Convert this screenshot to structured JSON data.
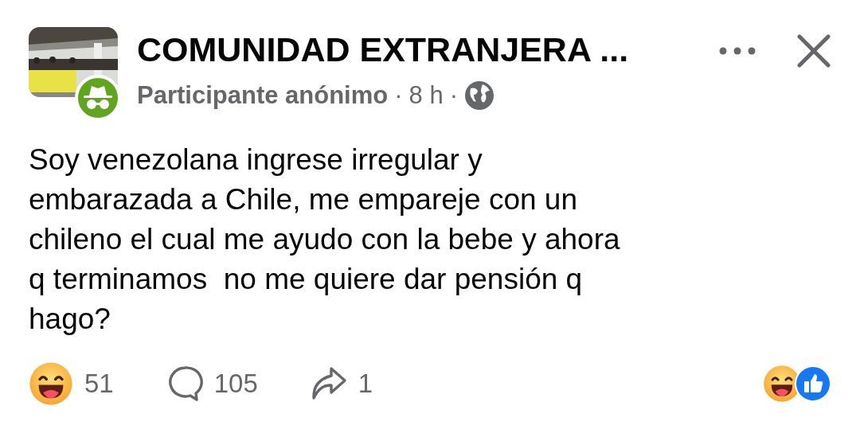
{
  "post": {
    "group_name": "COMUNIDAD EXTRANJERA ...",
    "author": "Participante anónimo",
    "separator_1": "·",
    "time": "8 h",
    "separator_2": "·",
    "body": "Soy venezolana ingrese irregular y\nembarazada a Chile, me empareje con un\nchileno el cual me ayudo con la bebe y ahora\nq terminamos  no me quiere dar pensión q\nhago?",
    "reactions": "51",
    "comments": "105",
    "shares": "1"
  }
}
